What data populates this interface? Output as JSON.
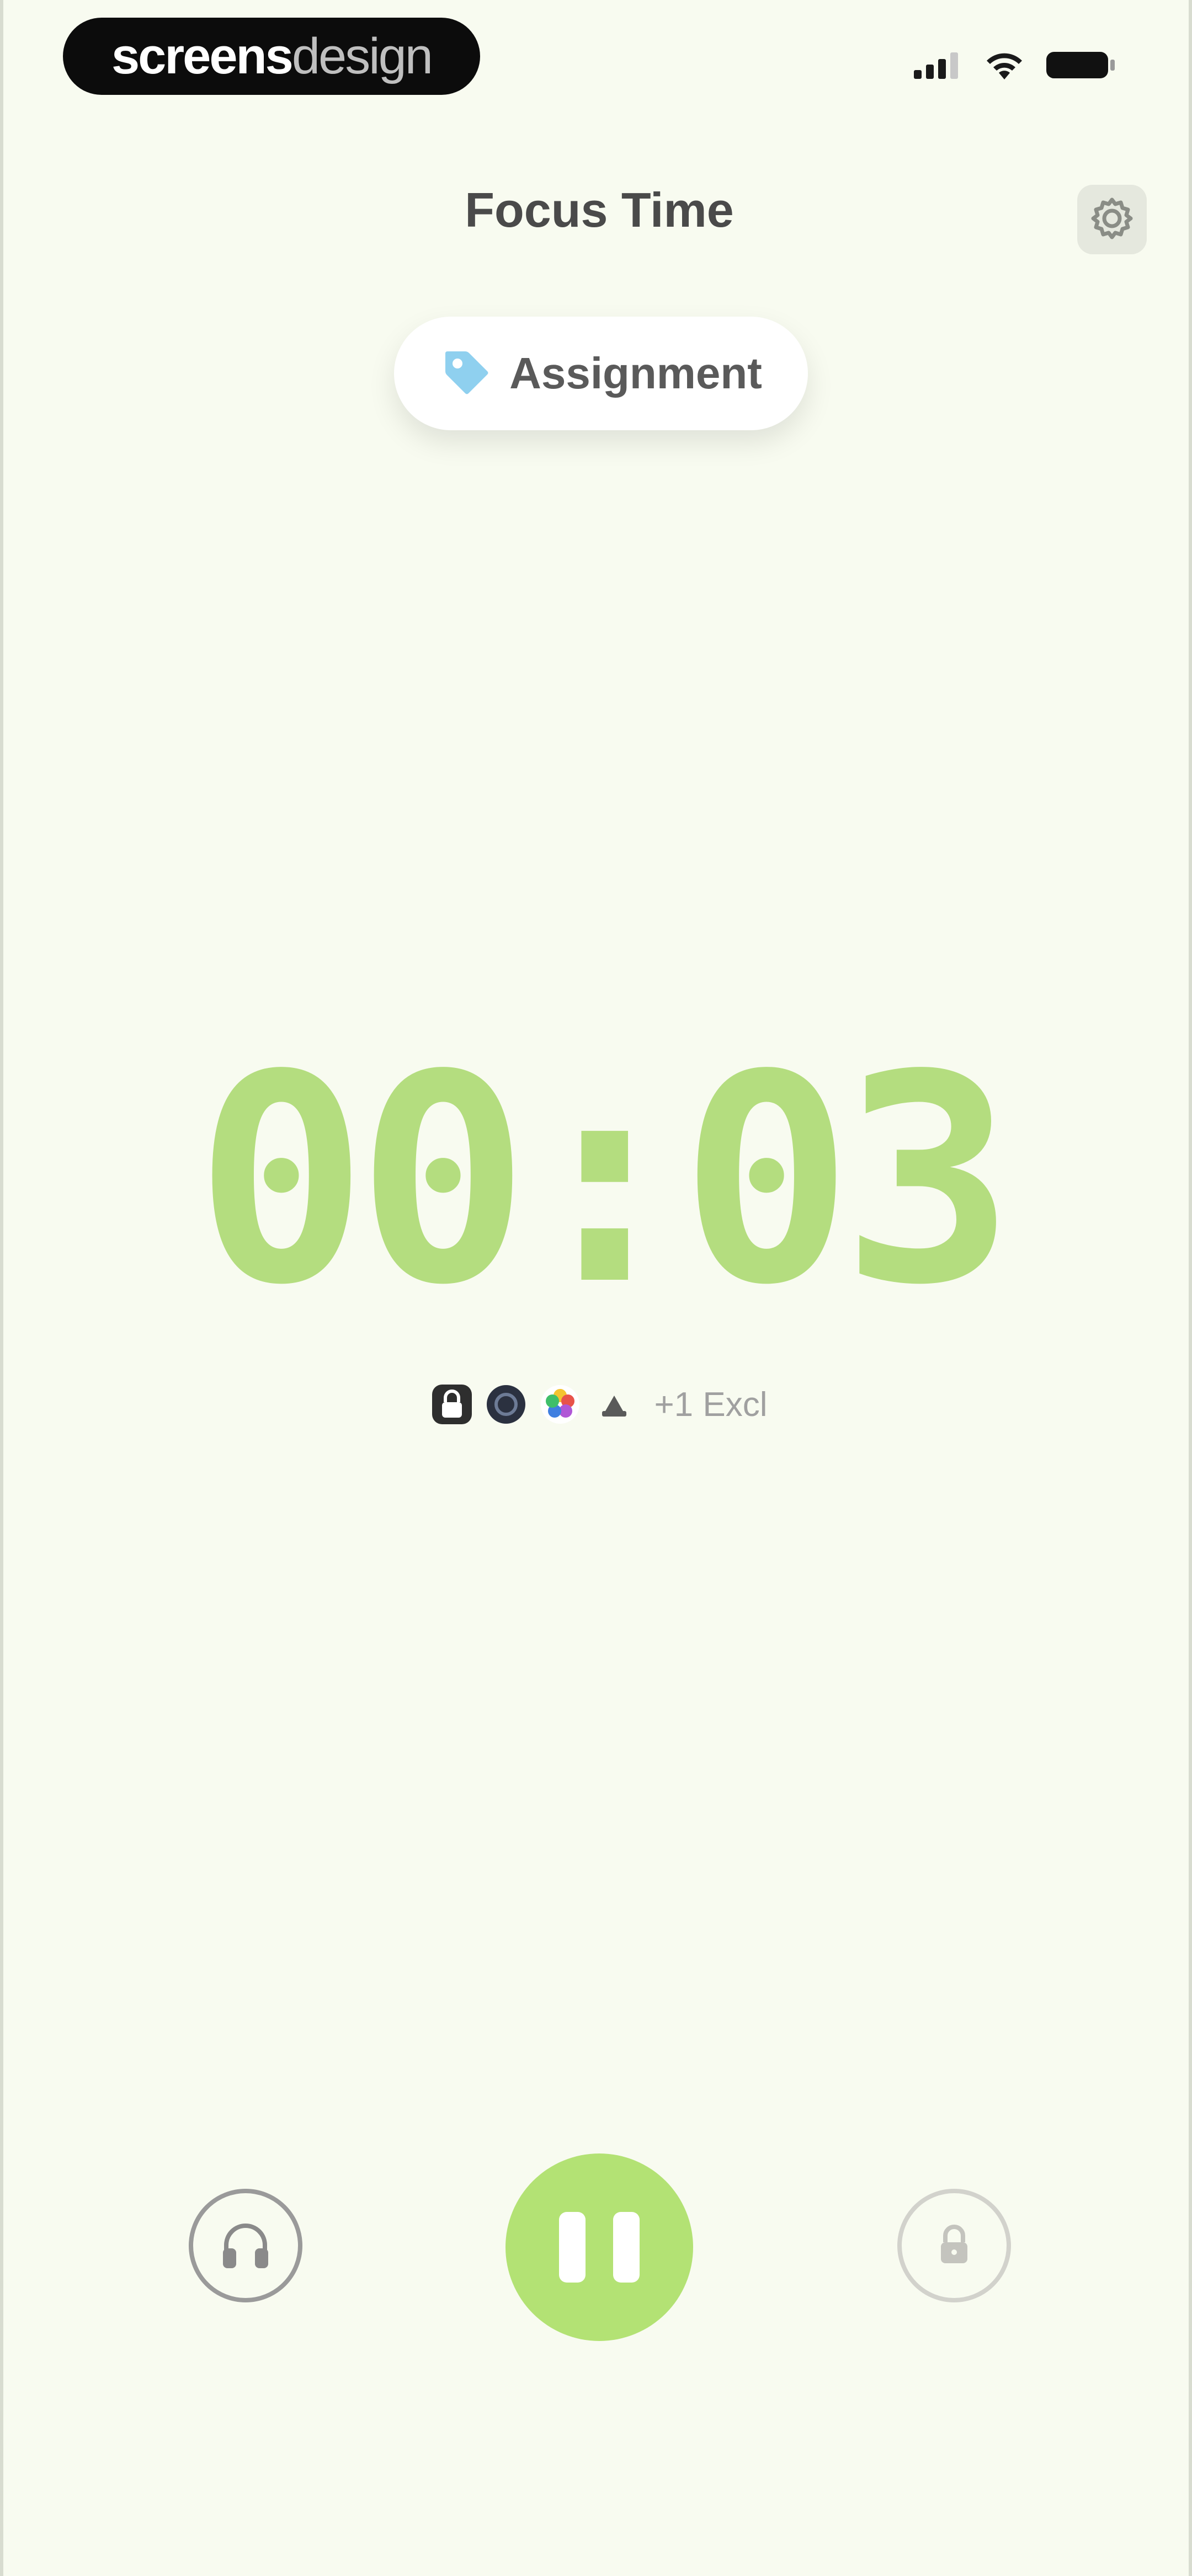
{
  "watermark": {
    "part1": "screens",
    "part2": "design"
  },
  "status_bar": {
    "signal_icon": "cellular-signal-icon",
    "wifi_icon": "wifi-icon",
    "battery_icon": "battery-icon"
  },
  "header": {
    "title": "Focus Time",
    "settings_icon": "gear-icon"
  },
  "tag": {
    "label": "Assignment",
    "icon": "tag-icon",
    "color": "#8fd0ef"
  },
  "timer": {
    "display": "00:03",
    "color": "#b4dd7f"
  },
  "blocked_apps": {
    "icons": [
      "lock-app-icon",
      "dark-app-icon",
      "color-wheel-app-icon",
      "drive-app-icon"
    ],
    "extra_label": "+1 Excl"
  },
  "controls": {
    "left_icon": "headphones-icon",
    "center_icon": "pause-icon",
    "right_icon": "lock-icon",
    "accent": "#b3e274"
  }
}
